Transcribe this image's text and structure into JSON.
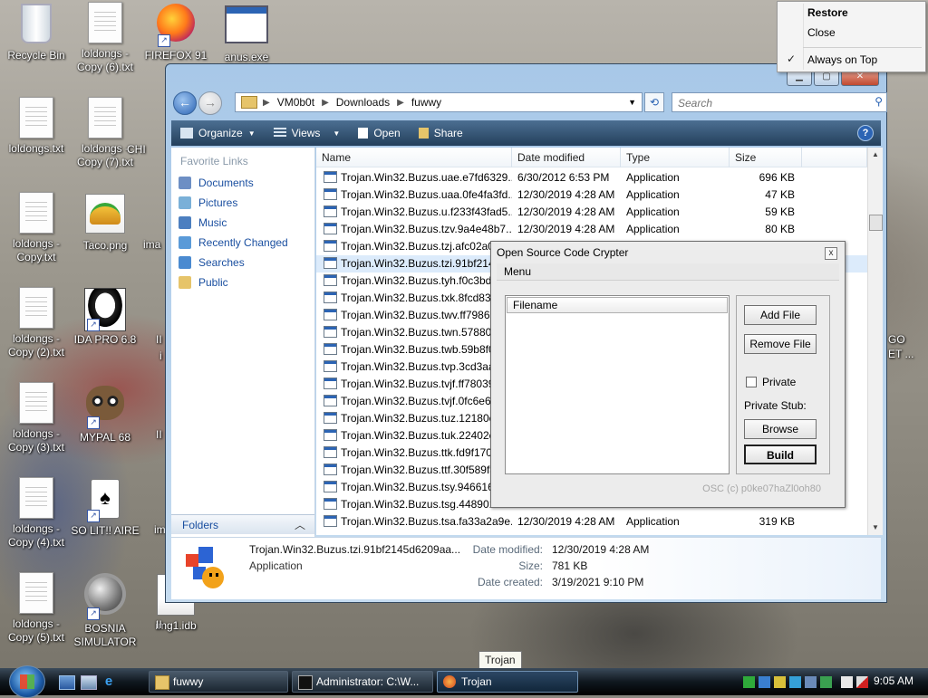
{
  "desktop": {
    "icons": [
      {
        "label": "Recycle Bin",
        "type": "bin"
      },
      {
        "label": "loldongs -\nCopy (6).txt",
        "type": "txt"
      },
      {
        "label": "FIREFOX 91",
        "type": "firefox"
      },
      {
        "label": "anus.exe",
        "type": "exe"
      },
      {
        "label": "loldongs.txt",
        "type": "txt"
      },
      {
        "label": "loldongs -\nCopy (7).txt",
        "type": "txt"
      },
      {
        "label": "loldongs -\nCopy.txt",
        "type": "txt"
      },
      {
        "label": "Taco.png",
        "type": "png"
      },
      {
        "label": "loldongs -\nCopy (2).txt",
        "type": "txt"
      },
      {
        "label": "IDA PRO 6.8",
        "type": "ida"
      },
      {
        "label": "loldongs -\nCopy (3).txt",
        "type": "txt"
      },
      {
        "label": "MYPAL 68",
        "type": "mypal"
      },
      {
        "label": "loldongs -\nCopy (4).txt",
        "type": "txt"
      },
      {
        "label": "SO LIT!! AIRE",
        "type": "cards"
      },
      {
        "label": "loldongs -\nCopy (5).txt",
        "type": "txt"
      },
      {
        "label": "BOSNIA\nSIMULATOR",
        "type": "mine"
      },
      {
        "label": "img1.idb",
        "type": "idb"
      }
    ],
    "partial_labels": [
      "CHI",
      "ima",
      "II",
      "i",
      "II",
      "im",
      "II",
      "GO",
      "ET ..."
    ]
  },
  "context_menu": {
    "items": [
      {
        "label": "Restore",
        "bold": true
      },
      {
        "label": "Close",
        "bold": false
      },
      {
        "label": "Always on Top",
        "checked": true
      }
    ],
    "check_glyph": "✓"
  },
  "explorer": {
    "breadcrumbs": [
      "VM0b0t",
      "Downloads",
      "fuwwy"
    ],
    "search_placeholder": "Search",
    "toolbar": {
      "organize": "Organize",
      "views": "Views",
      "open": "Open",
      "share": "Share",
      "help": "?"
    },
    "nav": {
      "favorite_links_header": "Favorite Links",
      "links": [
        "Documents",
        "Pictures",
        "Music",
        "Recently Changed",
        "Searches",
        "Public"
      ],
      "folders_label": "Folders"
    },
    "columns": [
      "Name",
      "Date modified",
      "Type",
      "Size"
    ],
    "files": [
      {
        "name": "Trojan.Win32.Buzus.uae.e7fd6329...",
        "date": "6/30/2012 6:53 PM",
        "type": "Application",
        "size": "696 KB"
      },
      {
        "name": "Trojan.Win32.Buzus.uaa.0fe4fa3fd...",
        "date": "12/30/2019 4:28 AM",
        "type": "Application",
        "size": "47 KB"
      },
      {
        "name": "Trojan.Win32.Buzus.u.f233f43fad5...",
        "date": "12/30/2019 4:28 AM",
        "type": "Application",
        "size": "59 KB"
      },
      {
        "name": "Trojan.Win32.Buzus.tzv.9a4e48b7...",
        "date": "12/30/2019 4:28 AM",
        "type": "Application",
        "size": "80 KB"
      },
      {
        "name": "Trojan.Win32.Buzus.tzj.afc02a08",
        "date": "",
        "type": "",
        "size": ""
      },
      {
        "name": "Trojan.Win32.Buzus.tzi.91bf2145",
        "date": "",
        "type": "",
        "size": "",
        "selected": true
      },
      {
        "name": "Trojan.Win32.Buzus.tyh.f0c3bd4",
        "date": "",
        "type": "",
        "size": ""
      },
      {
        "name": "Trojan.Win32.Buzus.txk.8fcd83e",
        "date": "",
        "type": "",
        "size": ""
      },
      {
        "name": "Trojan.Win32.Buzus.twv.ff79861",
        "date": "",
        "type": "",
        "size": ""
      },
      {
        "name": "Trojan.Win32.Buzus.twn.578805",
        "date": "",
        "type": "",
        "size": ""
      },
      {
        "name": "Trojan.Win32.Buzus.twb.59b8f0",
        "date": "",
        "type": "",
        "size": ""
      },
      {
        "name": "Trojan.Win32.Buzus.tvp.3cd3aa",
        "date": "",
        "type": "",
        "size": ""
      },
      {
        "name": "Trojan.Win32.Buzus.tvjf.ff78039",
        "date": "",
        "type": "",
        "size": ""
      },
      {
        "name": "Trojan.Win32.Buzus.tvjf.0fc6e6",
        "date": "",
        "type": "",
        "size": ""
      },
      {
        "name": "Trojan.Win32.Buzus.tuz.12180c",
        "date": "",
        "type": "",
        "size": ""
      },
      {
        "name": "Trojan.Win32.Buzus.tuk.22402e",
        "date": "",
        "type": "",
        "size": ""
      },
      {
        "name": "Trojan.Win32.Buzus.ttk.fd9f170",
        "date": "",
        "type": "",
        "size": ""
      },
      {
        "name": "Trojan.Win32.Buzus.ttf.30f589f3",
        "date": "",
        "type": "",
        "size": ""
      },
      {
        "name": "Trojan.Win32.Buzus.tsy.9466160",
        "date": "",
        "type": "",
        "size": ""
      },
      {
        "name": "Trojan.Win32.Buzus.tsg.448901f",
        "date": "",
        "type": "",
        "size": ""
      },
      {
        "name": "Trojan.Win32.Buzus.tsa.fa33a2a9e...",
        "date": "12/30/2019 4:28 AM",
        "type": "Application",
        "size": "319 KB"
      }
    ],
    "details": {
      "filename": "Trojan.Win32.Buzus.tzi.91bf2145d6209aa...",
      "type": "Application",
      "date_modified_label": "Date modified:",
      "date_modified": "12/30/2019 4:28 AM",
      "size_label": "Size:",
      "size": "781 KB",
      "date_created_label": "Date created:",
      "date_created": "3/19/2021 9:10 PM"
    }
  },
  "crypter": {
    "title": "Open Source Code Crypter",
    "menu": "Menu",
    "filename_header": "Filename",
    "add_file": "Add File",
    "remove_file": "Remove File",
    "private_label": "Private",
    "private_stub_label": "Private Stub:",
    "browse": "Browse",
    "build": "Build",
    "credit": "OSC (c) p0ke07haZl0oh80",
    "close_glyph": "x"
  },
  "taskbar": {
    "tasks": [
      {
        "label": "fuwwy",
        "active": false
      },
      {
        "label": "Administrator: C:\\W...",
        "active": false
      },
      {
        "label": "Trojan",
        "active": true
      }
    ],
    "tooltip": "Trojan",
    "clock": "9:05 AM"
  }
}
